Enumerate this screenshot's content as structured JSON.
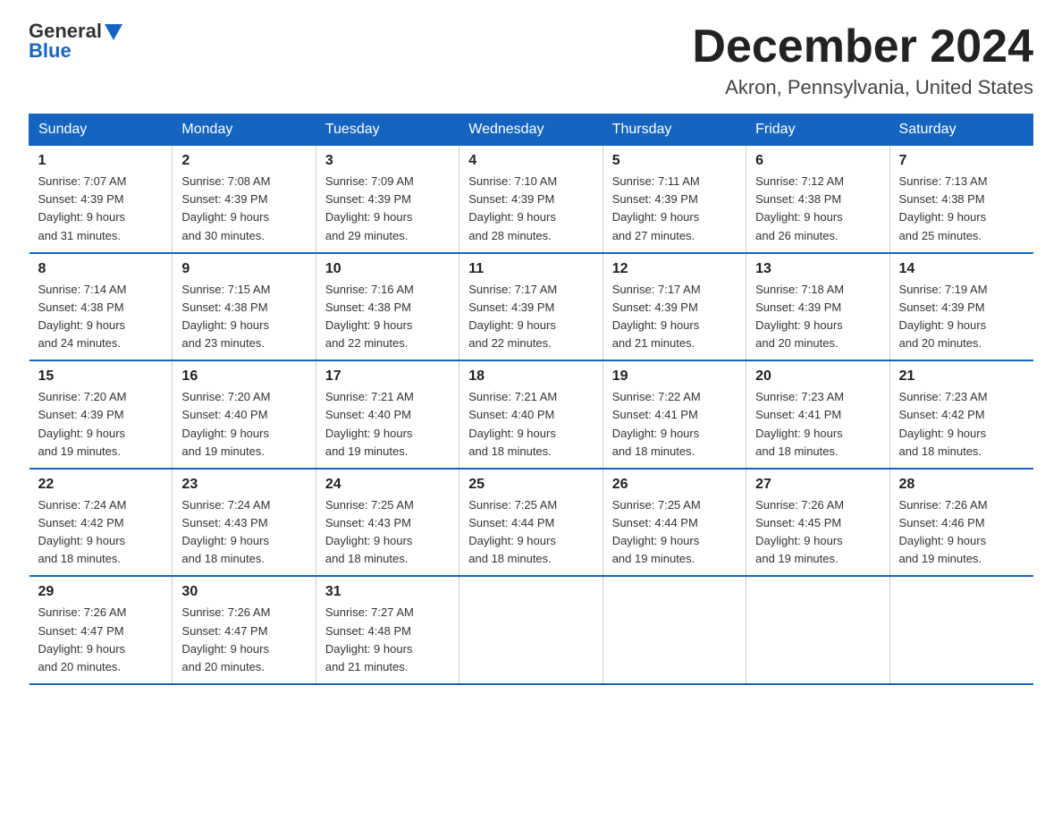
{
  "logo": {
    "general": "General",
    "blue": "Blue"
  },
  "title": "December 2024",
  "location": "Akron, Pennsylvania, United States",
  "days_of_week": [
    "Sunday",
    "Monday",
    "Tuesday",
    "Wednesday",
    "Thursday",
    "Friday",
    "Saturday"
  ],
  "weeks": [
    [
      {
        "day": "1",
        "sunrise": "7:07 AM",
        "sunset": "4:39 PM",
        "daylight": "9 hours and 31 minutes."
      },
      {
        "day": "2",
        "sunrise": "7:08 AM",
        "sunset": "4:39 PM",
        "daylight": "9 hours and 30 minutes."
      },
      {
        "day": "3",
        "sunrise": "7:09 AM",
        "sunset": "4:39 PM",
        "daylight": "9 hours and 29 minutes."
      },
      {
        "day": "4",
        "sunrise": "7:10 AM",
        "sunset": "4:39 PM",
        "daylight": "9 hours and 28 minutes."
      },
      {
        "day": "5",
        "sunrise": "7:11 AM",
        "sunset": "4:39 PM",
        "daylight": "9 hours and 27 minutes."
      },
      {
        "day": "6",
        "sunrise": "7:12 AM",
        "sunset": "4:38 PM",
        "daylight": "9 hours and 26 minutes."
      },
      {
        "day": "7",
        "sunrise": "7:13 AM",
        "sunset": "4:38 PM",
        "daylight": "9 hours and 25 minutes."
      }
    ],
    [
      {
        "day": "8",
        "sunrise": "7:14 AM",
        "sunset": "4:38 PM",
        "daylight": "9 hours and 24 minutes."
      },
      {
        "day": "9",
        "sunrise": "7:15 AM",
        "sunset": "4:38 PM",
        "daylight": "9 hours and 23 minutes."
      },
      {
        "day": "10",
        "sunrise": "7:16 AM",
        "sunset": "4:38 PM",
        "daylight": "9 hours and 22 minutes."
      },
      {
        "day": "11",
        "sunrise": "7:17 AM",
        "sunset": "4:39 PM",
        "daylight": "9 hours and 22 minutes."
      },
      {
        "day": "12",
        "sunrise": "7:17 AM",
        "sunset": "4:39 PM",
        "daylight": "9 hours and 21 minutes."
      },
      {
        "day": "13",
        "sunrise": "7:18 AM",
        "sunset": "4:39 PM",
        "daylight": "9 hours and 20 minutes."
      },
      {
        "day": "14",
        "sunrise": "7:19 AM",
        "sunset": "4:39 PM",
        "daylight": "9 hours and 20 minutes."
      }
    ],
    [
      {
        "day": "15",
        "sunrise": "7:20 AM",
        "sunset": "4:39 PM",
        "daylight": "9 hours and 19 minutes."
      },
      {
        "day": "16",
        "sunrise": "7:20 AM",
        "sunset": "4:40 PM",
        "daylight": "9 hours and 19 minutes."
      },
      {
        "day": "17",
        "sunrise": "7:21 AM",
        "sunset": "4:40 PM",
        "daylight": "9 hours and 19 minutes."
      },
      {
        "day": "18",
        "sunrise": "7:21 AM",
        "sunset": "4:40 PM",
        "daylight": "9 hours and 18 minutes."
      },
      {
        "day": "19",
        "sunrise": "7:22 AM",
        "sunset": "4:41 PM",
        "daylight": "9 hours and 18 minutes."
      },
      {
        "day": "20",
        "sunrise": "7:23 AM",
        "sunset": "4:41 PM",
        "daylight": "9 hours and 18 minutes."
      },
      {
        "day": "21",
        "sunrise": "7:23 AM",
        "sunset": "4:42 PM",
        "daylight": "9 hours and 18 minutes."
      }
    ],
    [
      {
        "day": "22",
        "sunrise": "7:24 AM",
        "sunset": "4:42 PM",
        "daylight": "9 hours and 18 minutes."
      },
      {
        "day": "23",
        "sunrise": "7:24 AM",
        "sunset": "4:43 PM",
        "daylight": "9 hours and 18 minutes."
      },
      {
        "day": "24",
        "sunrise": "7:25 AM",
        "sunset": "4:43 PM",
        "daylight": "9 hours and 18 minutes."
      },
      {
        "day": "25",
        "sunrise": "7:25 AM",
        "sunset": "4:44 PM",
        "daylight": "9 hours and 18 minutes."
      },
      {
        "day": "26",
        "sunrise": "7:25 AM",
        "sunset": "4:44 PM",
        "daylight": "9 hours and 19 minutes."
      },
      {
        "day": "27",
        "sunrise": "7:26 AM",
        "sunset": "4:45 PM",
        "daylight": "9 hours and 19 minutes."
      },
      {
        "day": "28",
        "sunrise": "7:26 AM",
        "sunset": "4:46 PM",
        "daylight": "9 hours and 19 minutes."
      }
    ],
    [
      {
        "day": "29",
        "sunrise": "7:26 AM",
        "sunset": "4:47 PM",
        "daylight": "9 hours and 20 minutes."
      },
      {
        "day": "30",
        "sunrise": "7:26 AM",
        "sunset": "4:47 PM",
        "daylight": "9 hours and 20 minutes."
      },
      {
        "day": "31",
        "sunrise": "7:27 AM",
        "sunset": "4:48 PM",
        "daylight": "9 hours and 21 minutes."
      },
      null,
      null,
      null,
      null
    ]
  ],
  "labels": {
    "sunrise": "Sunrise:",
    "sunset": "Sunset:",
    "daylight": "Daylight:"
  }
}
